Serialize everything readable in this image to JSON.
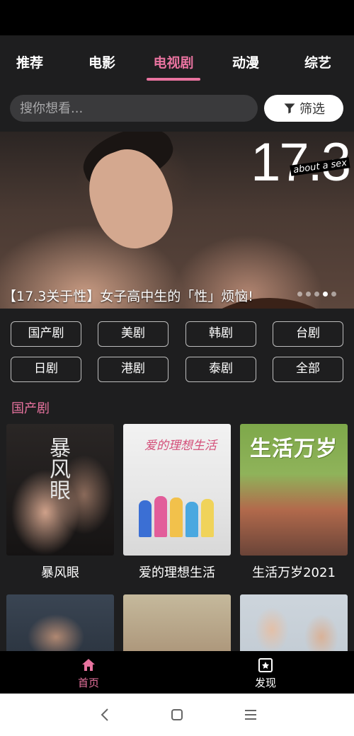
{
  "tabs": [
    {
      "label": "推荐"
    },
    {
      "label": "电影"
    },
    {
      "label": "电视剧",
      "active": true
    },
    {
      "label": "动漫"
    },
    {
      "label": "综艺"
    }
  ],
  "search": {
    "placeholder": "搜你想看...",
    "value": "",
    "filter_label": "筛选",
    "filter_icon": "filter-icon"
  },
  "banner": {
    "logo_text": "17.3",
    "logo_sub": "about a sex",
    "title": "【17.3关于性】女子高中生的「性」烦恼!",
    "dots_count": 5,
    "active_dot": 3
  },
  "categories": [
    "国产剧",
    "美剧",
    "韩剧",
    "台剧",
    "日剧",
    "港剧",
    "泰剧",
    "全部"
  ],
  "section": {
    "title": "国产剧",
    "items": [
      {
        "title": "暴风眼",
        "poster_text": "暴风眼"
      },
      {
        "title": "爱的理想生活",
        "poster_text": "爱的理想生活"
      },
      {
        "title": "生活万岁2021",
        "poster_text": "生活万岁"
      }
    ]
  },
  "bottom_nav": [
    {
      "label": "首页",
      "icon": "home-icon",
      "active": true
    },
    {
      "label": "发现",
      "icon": "discover-icon",
      "active": false
    }
  ],
  "colors": {
    "accent": "#e8739f",
    "background": "#1e1e1f"
  }
}
